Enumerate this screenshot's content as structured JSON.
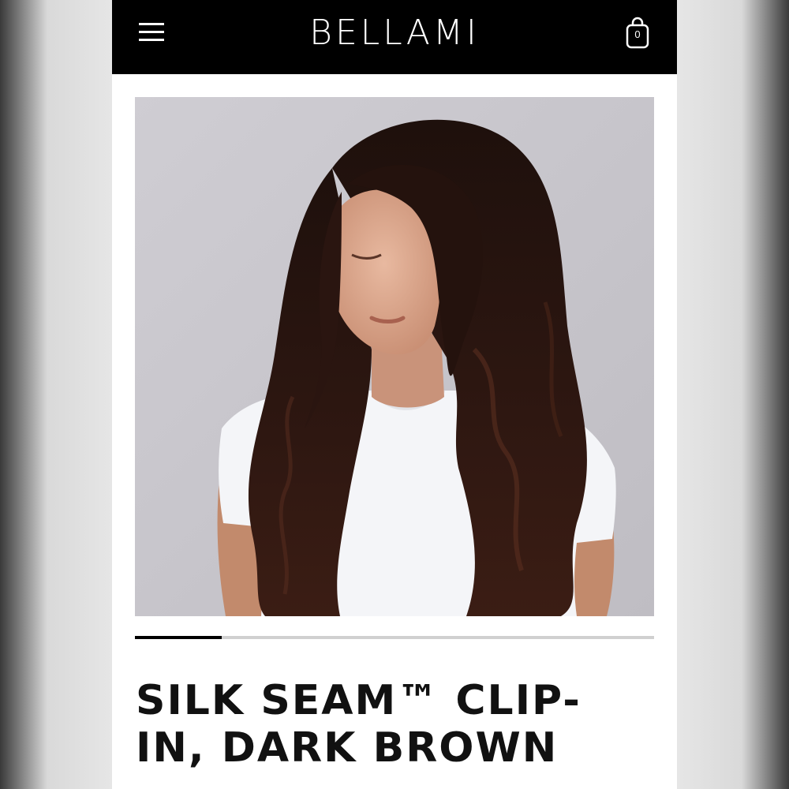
{
  "header": {
    "logo": "BELLAMI",
    "menu_icon": "hamburger-menu-icon",
    "cart_icon": "shopping-bag-icon",
    "cart_count": "0"
  },
  "hero": {
    "image_alt": "Model with long wavy dark brown hair wearing a white t-shirt",
    "carousel_progress": 0.167
  },
  "product": {
    "title_line1": "SILK SEAM™ CLIP-",
    "title_line2": "IN, DARK BROWN"
  },
  "colors": {
    "header_bg": "#000000",
    "accent": "#111111",
    "hair": "#2a1510",
    "backdrop": "#c9c7cd"
  }
}
